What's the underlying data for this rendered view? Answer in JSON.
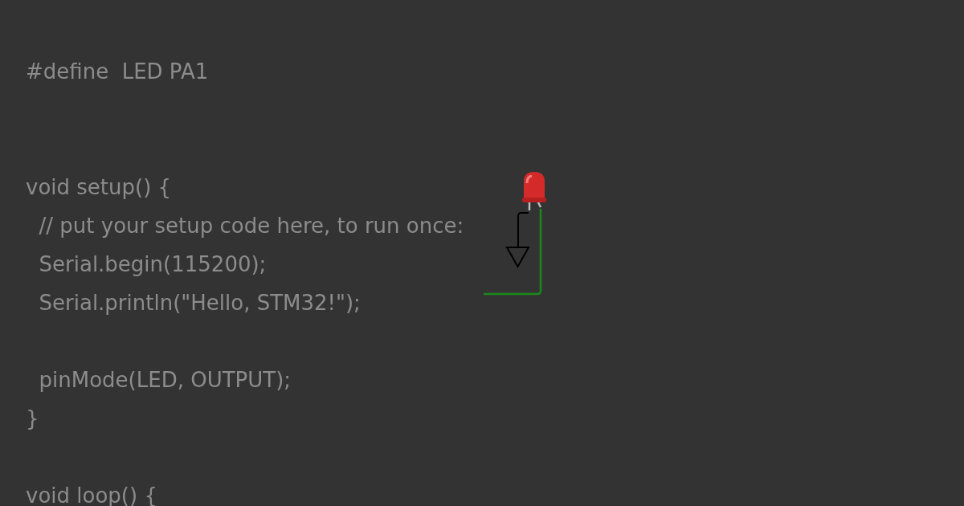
{
  "editor": {
    "lines": [
      {
        "kind": "code",
        "text": "#define  LED PA1"
      },
      {
        "kind": "blank"
      },
      {
        "kind": "blank"
      },
      {
        "kind": "code",
        "text": "void setup() {"
      },
      {
        "kind": "code",
        "text": "  // put your setup code here, to run once:"
      },
      {
        "kind": "code",
        "text": "  Serial.begin(115200);"
      },
      {
        "kind": "code",
        "text": "  Serial.println(\"Hello, STM32!\");"
      },
      {
        "kind": "blank"
      },
      {
        "kind": "code",
        "text": "  pinMode(LED, OUTPUT);"
      },
      {
        "kind": "code",
        "text": "}"
      },
      {
        "kind": "blank"
      },
      {
        "kind": "code",
        "text": "void loop() {"
      }
    ]
  }
}
